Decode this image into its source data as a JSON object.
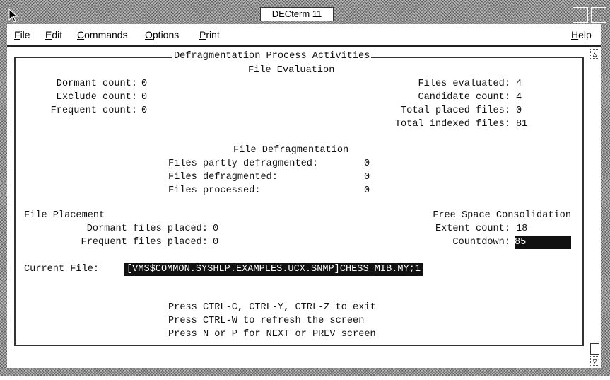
{
  "window": {
    "title": "DECterm 11",
    "menu": [
      {
        "label": "File",
        "mnemonic": "F",
        "rest": "ile"
      },
      {
        "label": "Edit",
        "mnemonic": "E",
        "rest": "dit"
      },
      {
        "label": "Commands",
        "mnemonic": "C",
        "rest": "ommands"
      },
      {
        "label": "Options",
        "mnemonic": "O",
        "rest": "ptions"
      },
      {
        "label": "Print",
        "mnemonic": "P",
        "rest": "rint"
      }
    ],
    "help": {
      "label": "Help",
      "mnemonic": "H",
      "rest": "elp"
    },
    "scroll_up_icon": "▵",
    "scroll_down_icon": "▿"
  },
  "screen": {
    "title": "Defragmentation Process Activities",
    "file_evaluation": {
      "heading": "File Evaluation",
      "left": [
        {
          "label": "Dormant count:",
          "value": "0"
        },
        {
          "label": "Exclude count:",
          "value": "0"
        },
        {
          "label": "Frequent count:",
          "value": "0"
        }
      ],
      "right": [
        {
          "label": "Files evaluated:",
          "value": "4"
        },
        {
          "label": "Candidate count:",
          "value": "4"
        },
        {
          "label": "Total placed files:",
          "value": "0"
        },
        {
          "label": "Total indexed files:",
          "value": "81"
        }
      ]
    },
    "file_defragmentation": {
      "heading": "File Defragmentation",
      "rows": [
        {
          "label": "Files partly defragmented:",
          "value": "0"
        },
        {
          "label": "Files defragmented:",
          "value": "0"
        },
        {
          "label": "Files processed:",
          "value": "0"
        }
      ]
    },
    "file_placement": {
      "heading": "File Placement",
      "rows": [
        {
          "label": "Dormant files placed:",
          "value": "0"
        },
        {
          "label": "Frequent files placed:",
          "value": "0"
        }
      ]
    },
    "free_space_consolidation": {
      "heading": "Free Space Consolidation",
      "extent_label": "Extent count:",
      "extent_value": "18",
      "countdown_label": "Countdown:",
      "countdown_value": "85"
    },
    "current_file": {
      "label": "Current File:",
      "value": "[VMS$COMMON.SYSHLP.EXAMPLES.UCX.SNMP]CHESS_MIB.MY;1"
    },
    "instructions": [
      "Press CTRL-C, CTRL-Y, CTRL-Z to exit",
      "Press CTRL-W to refresh the screen",
      "Press N or P for NEXT or PREV screen"
    ]
  }
}
